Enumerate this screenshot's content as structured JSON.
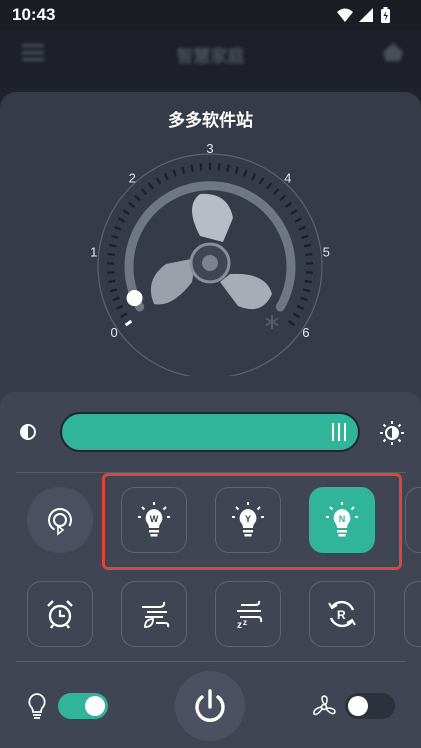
{
  "status_bar": {
    "time": "10:43",
    "icons": [
      "wifi-icon",
      "signal-icon",
      "battery-icon"
    ]
  },
  "app_bar": {
    "title": "智慧家庭",
    "icons": [
      "menu-icon",
      "add-device-icon"
    ]
  },
  "sheet": {
    "title": "多多软件站"
  },
  "speed_dial": {
    "ticks": [
      "0",
      "1",
      "2",
      "3",
      "4",
      "5",
      "6"
    ],
    "current_level": 0,
    "max_level": 6,
    "center_icon": "fan-blade-icon",
    "snow_icon": "snowflake-icon"
  },
  "brightness": {
    "icon_left": "contrast-icon",
    "icon_right": "brightness-icon",
    "level": 1.0
  },
  "light_modes": [
    {
      "letter": "W",
      "name": "warm-light",
      "active": false
    },
    {
      "letter": "Y",
      "name": "yellow-light",
      "active": false
    },
    {
      "letter": "N",
      "name": "neutral-light",
      "active": true
    }
  ],
  "functions": [
    {
      "name": "timer",
      "icon": "alarm-clock-icon"
    },
    {
      "name": "natural-wind",
      "icon": "leaf-wind-icon"
    },
    {
      "name": "sleep-wind",
      "icon": "sleep-wind-icon"
    },
    {
      "name": "rotate",
      "icon": "rotate-r-icon"
    }
  ],
  "footer": {
    "light_toggle": {
      "icon": "bulb-icon",
      "on": true
    },
    "fan_toggle": {
      "icon": "fan-icon",
      "on": false
    },
    "power_icon": "power-icon"
  },
  "colors": {
    "accent": "#30b49a",
    "highlight": "#d9473a",
    "sheet": "#353b47",
    "panel": "#3f4553"
  }
}
